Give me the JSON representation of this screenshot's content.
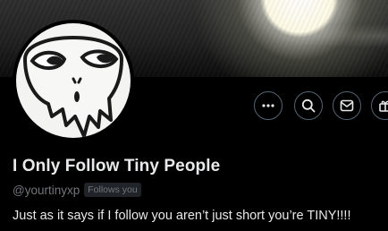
{
  "profile": {
    "display_name": "I Only Follow Tiny People",
    "handle": "@yourtinyxp",
    "follows_you_badge": "Follows you",
    "bio": "Just as it says if I follow you aren’t just short you’re TINY!!!!"
  },
  "actions": {
    "more_icon": "ellipsis-icon",
    "search_icon": "search-icon",
    "message_icon": "mail-icon",
    "subscribe_icon": "gift-icon"
  },
  "colors": {
    "background": "#000000",
    "text_primary": "#e7e9ea",
    "text_secondary": "#71767b",
    "button_border": "#536471",
    "badge_bg": "#202327"
  }
}
